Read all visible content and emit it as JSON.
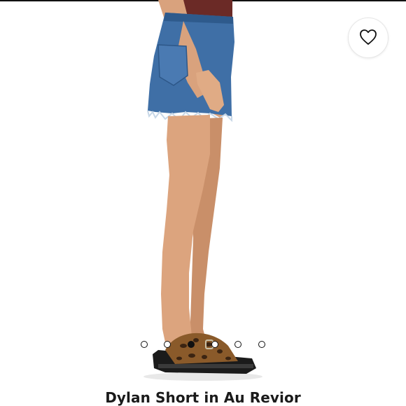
{
  "product": {
    "title": "Dylan Short in Au Revior"
  },
  "favorite": {
    "icon": "heart-icon"
  },
  "carousel": {
    "count": 6,
    "active": 2
  },
  "colors": {
    "text": "#1a1a1a",
    "denim": "#3f6fa6",
    "top": "#6b2a26",
    "skin": "#d7a07a",
    "sandal": "#1b1b1b",
    "leopard": "#8a5a2a"
  }
}
